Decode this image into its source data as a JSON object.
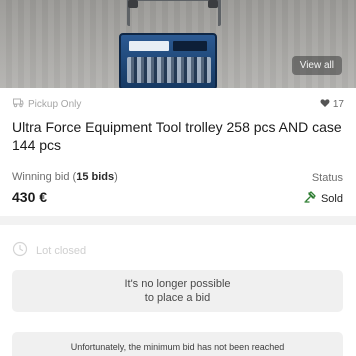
{
  "gallery": {
    "view_all_label": "View all"
  },
  "listing": {
    "pickup_label": "Pickup Only",
    "favorites_count": "17",
    "title": "Ultra Force Equipment Tool trolley 258 pcs AND case 144 pcs"
  },
  "bidding": {
    "winning_bid_prefix": "Winning bid (",
    "bids_count": "15 bids",
    "winning_bid_suffix": ")",
    "price": "430 €",
    "status_label": "Status",
    "status_value": "Sold"
  },
  "closed": {
    "lot_closed_label": "Lot closed",
    "no_bid_line1": "It's no longer possible",
    "no_bid_line2": "to place a bid",
    "minimum_bid_notice": "Unfortunately, the minimum bid has not been reached"
  },
  "colors": {
    "sold_icon": "#2e7d32",
    "muted": "#a6a6a6",
    "box_bg": "#f0f0f0"
  }
}
